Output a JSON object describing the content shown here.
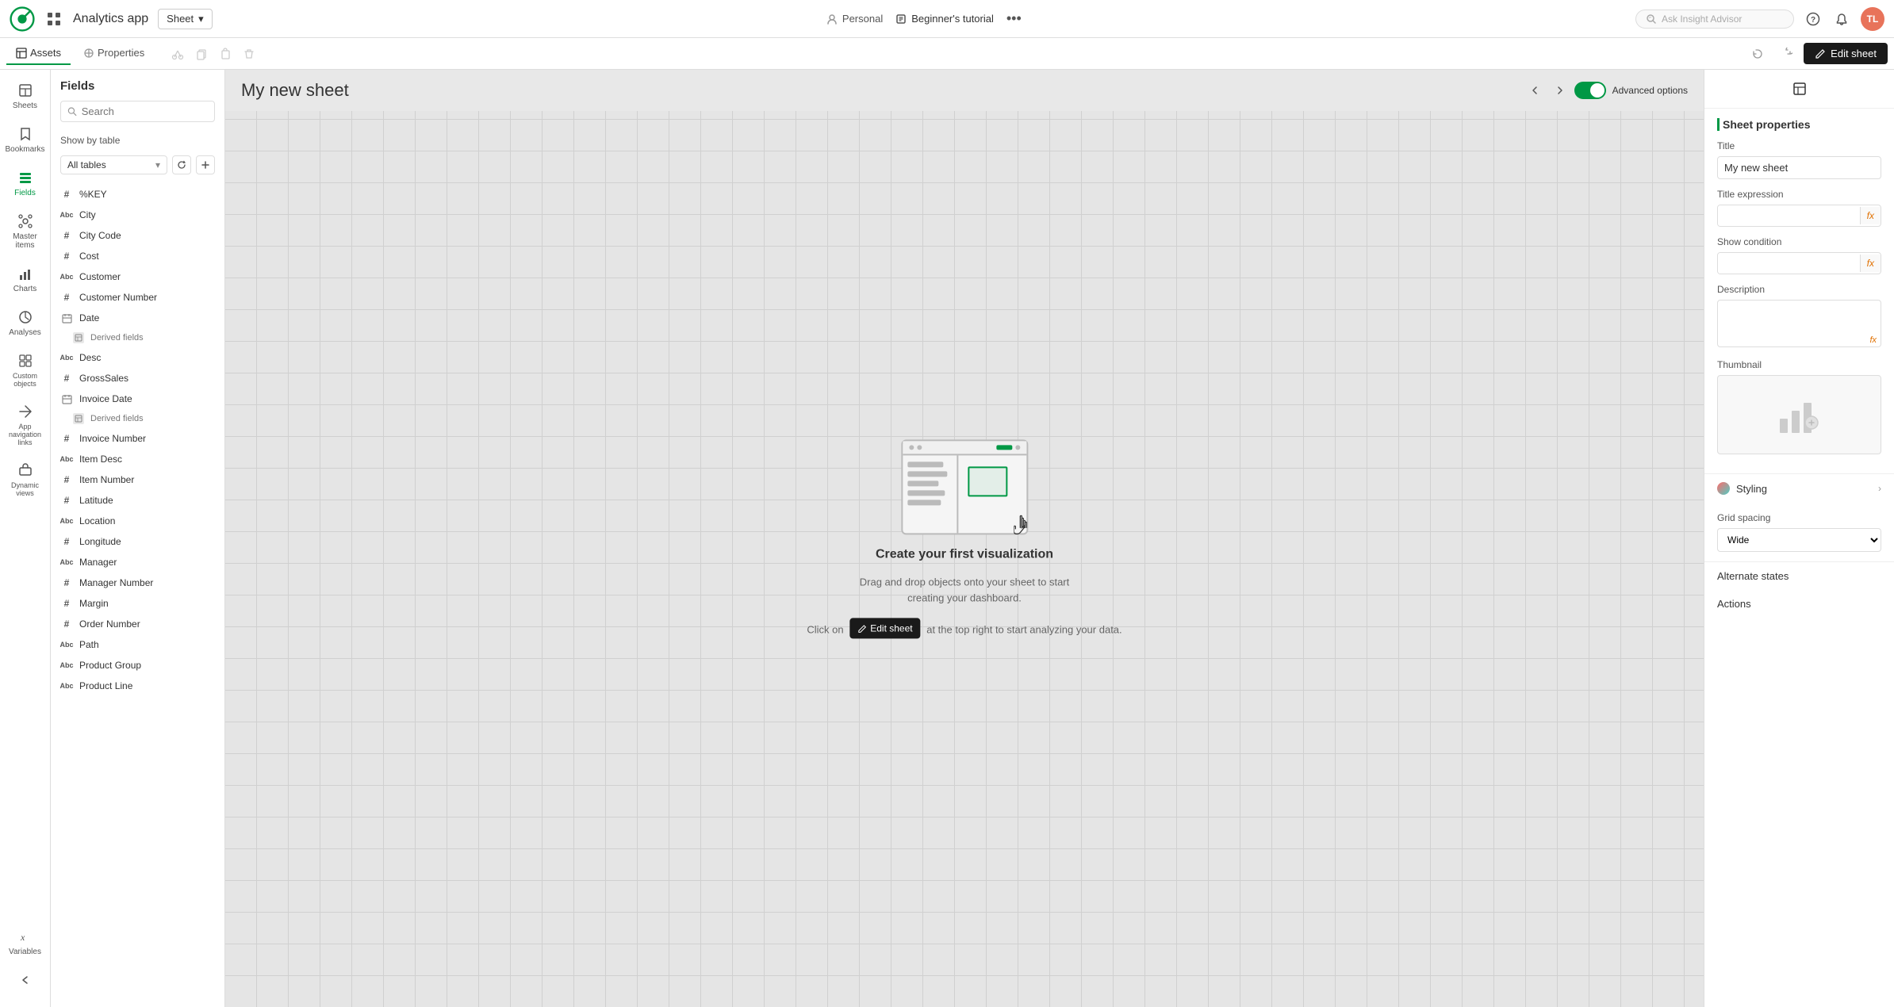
{
  "navbar": {
    "logo_alt": "Qlik",
    "app_name": "Analytics app",
    "sheet_selector": "Sheet",
    "personal_label": "Personal",
    "tutorial_label": "Beginner's tutorial",
    "insight_placeholder": "Ask Insight Advisor",
    "avatar_initials": "TL"
  },
  "sub_toolbar": {
    "tab_assets": "Assets",
    "tab_properties": "Properties",
    "edit_sheet_label": "Edit sheet"
  },
  "sidebar": {
    "items": [
      {
        "id": "sheets",
        "label": "Sheets"
      },
      {
        "id": "bookmarks",
        "label": "Bookmarks"
      },
      {
        "id": "fields",
        "label": "Fields"
      },
      {
        "id": "master-items",
        "label": "Master items"
      },
      {
        "id": "charts",
        "label": "Charts"
      },
      {
        "id": "analyses",
        "label": "Analyses"
      },
      {
        "id": "custom-objects",
        "label": "Custom objects"
      },
      {
        "id": "app-navigation",
        "label": "App navigation links"
      },
      {
        "id": "dynamic-views",
        "label": "Dynamic views"
      }
    ],
    "bottom": [
      {
        "id": "variables",
        "label": "Variables"
      },
      {
        "id": "collapse",
        "label": ""
      }
    ]
  },
  "fields_panel": {
    "title": "Fields",
    "search_placeholder": "Search",
    "show_by_label": "Show by table",
    "table_select": "All tables",
    "fields": [
      {
        "type": "hash",
        "name": "%KEY",
        "indent": 0
      },
      {
        "type": "abc",
        "name": "City",
        "indent": 0
      },
      {
        "type": "hash",
        "name": "City Code",
        "indent": 0
      },
      {
        "type": "hash",
        "name": "Cost",
        "indent": 0
      },
      {
        "type": "abc",
        "name": "Customer",
        "indent": 0
      },
      {
        "type": "hash",
        "name": "Customer Number",
        "indent": 0
      },
      {
        "type": "cal",
        "name": "Date",
        "indent": 0
      },
      {
        "type": "derived",
        "name": "Derived fields",
        "indent": 1
      },
      {
        "type": "abc",
        "name": "Desc",
        "indent": 0
      },
      {
        "type": "hash",
        "name": "GrossSales",
        "indent": 0
      },
      {
        "type": "cal",
        "name": "Invoice Date",
        "indent": 0
      },
      {
        "type": "derived",
        "name": "Derived fields",
        "indent": 1
      },
      {
        "type": "hash",
        "name": "Invoice Number",
        "indent": 0
      },
      {
        "type": "abc",
        "name": "Item Desc",
        "indent": 0
      },
      {
        "type": "hash",
        "name": "Item Number",
        "indent": 0
      },
      {
        "type": "hash",
        "name": "Latitude",
        "indent": 0
      },
      {
        "type": "abc",
        "name": "Location",
        "indent": 0
      },
      {
        "type": "hash",
        "name": "Longitude",
        "indent": 0
      },
      {
        "type": "abc",
        "name": "Manager",
        "indent": 0
      },
      {
        "type": "hash",
        "name": "Manager Number",
        "indent": 0
      },
      {
        "type": "hash",
        "name": "Margin",
        "indent": 0
      },
      {
        "type": "hash",
        "name": "Order Number",
        "indent": 0
      },
      {
        "type": "abc",
        "name": "Path",
        "indent": 0
      },
      {
        "type": "abc",
        "name": "Product Group",
        "indent": 0
      },
      {
        "type": "abc",
        "name": "Product Line",
        "indent": 0
      }
    ]
  },
  "sheet": {
    "title": "My new sheet",
    "advanced_options_label": "Advanced options",
    "create_viz_title": "Create your first visualization",
    "create_viz_desc": "Drag and drop objects onto your sheet to start creating your dashboard.",
    "create_viz_action_prefix": "Click on",
    "create_viz_action_suffix": "at the top right to start analyzing your data.",
    "edit_sheet_label": "Edit sheet"
  },
  "right_panel": {
    "section_title": "Sheet properties",
    "title_label": "Title",
    "title_value": "My new sheet",
    "title_expression_label": "Title expression",
    "show_condition_label": "Show condition",
    "description_label": "Description",
    "thumbnail_label": "Thumbnail",
    "styling_label": "Styling",
    "grid_spacing_label": "Grid spacing",
    "grid_spacing_value": "Wide",
    "alternate_states_label": "Alternate states",
    "actions_label": "Actions"
  }
}
